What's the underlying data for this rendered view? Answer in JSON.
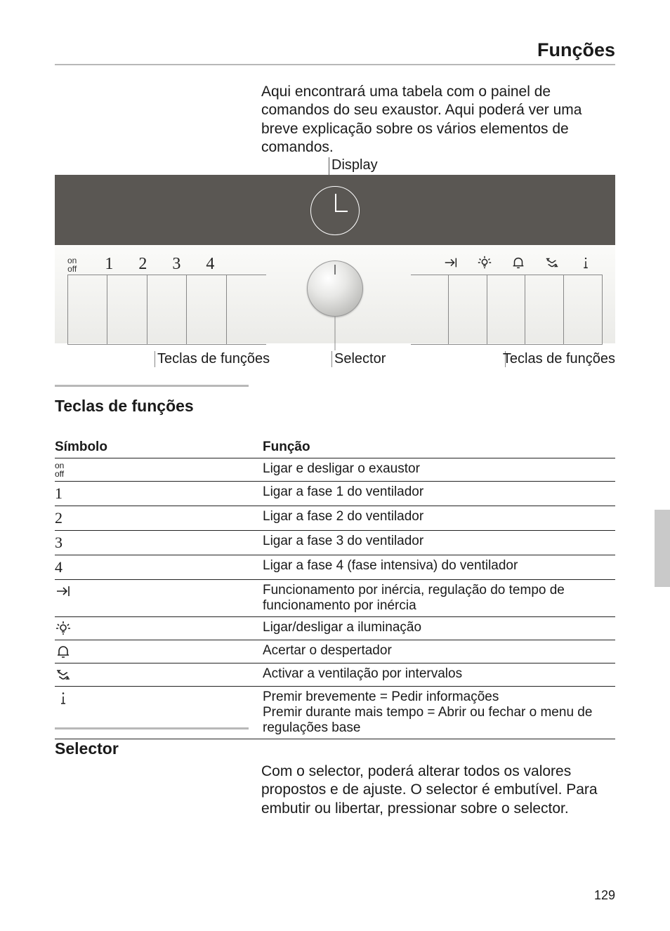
{
  "header": {
    "title": "Funções"
  },
  "intro": "Aqui encontrará uma tabela com o painel de comandos do seu exaustor. Aqui poderá ver uma breve explicação sobre os vários elementos de comandos.",
  "panel": {
    "display_label": "Display",
    "left_keys": {
      "onoff_top": "on",
      "onoff_bottom": "off",
      "nums": [
        "1",
        "2",
        "3",
        "4"
      ]
    },
    "labels": {
      "left": "Teclas de funções",
      "selector": "Selector",
      "right": "Teclas de funções"
    }
  },
  "sections": {
    "teclas": "Teclas de funções",
    "selector": "Selector"
  },
  "table": {
    "h1": "Símbolo",
    "h2": "Função",
    "rows": [
      {
        "sym": "onoff",
        "desc": "Ligar e desligar o exaustor"
      },
      {
        "sym": "1",
        "desc": "Ligar a fase 1 do ventilador"
      },
      {
        "sym": "2",
        "desc": "Ligar a fase 2 do ventilador"
      },
      {
        "sym": "3",
        "desc": "Ligar a fase 3 do ventilador"
      },
      {
        "sym": "4",
        "desc": "Ligar a fase 4 (fase intensiva) do ventilador"
      },
      {
        "sym": "arrow",
        "desc": "Funcionamento por inércia, regulação do tempo de funcionamento por inércia"
      },
      {
        "sym": "lamp",
        "desc": "Ligar/desligar a iluminação"
      },
      {
        "sym": "bell",
        "desc": "Acertar o despertador"
      },
      {
        "sym": "interval",
        "desc": "Activar a ventilação por intervalos"
      },
      {
        "sym": "info",
        "desc": "Premir brevemente = Pedir informações\nPremir durante mais tempo = Abrir ou fechar o menu de regulações base"
      }
    ]
  },
  "selector_text": "Com o selector, poderá alterar todos os valores propostos e de ajuste. O selector é embutível. Para embutir ou libertar, pressionar sobre o selector.",
  "page_number": "129"
}
